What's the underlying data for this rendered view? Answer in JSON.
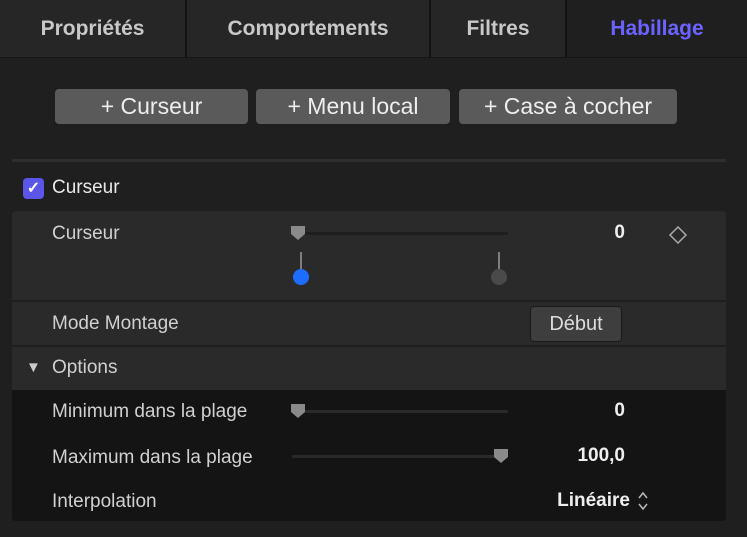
{
  "tabs": [
    {
      "label": "Propriétés"
    },
    {
      "label": "Comportements"
    },
    {
      "label": "Filtres"
    },
    {
      "label": "Habillage"
    }
  ],
  "buttons": {
    "add_slider": "+ Curseur",
    "add_popup": "+ Menu local",
    "add_checkbox": "+ Case à cocher"
  },
  "section": {
    "label": "Curseur",
    "checked": true
  },
  "slider_row": {
    "label": "Curseur",
    "value": "0",
    "fraction": 0
  },
  "edit_mode": {
    "label": "Mode Montage",
    "button": "Début"
  },
  "options": {
    "label": "Options",
    "min": {
      "label": "Minimum dans la plage",
      "value": "0",
      "fraction": 0
    },
    "max": {
      "label": "Maximum dans la plage",
      "value": "100,0",
      "fraction": 1
    },
    "interpolation": {
      "label": "Interpolation",
      "value": "Linéaire"
    }
  },
  "colors": {
    "accent": "#6b63ff",
    "checkbox": "#5b55e8",
    "blue_knob": "#1e6bff"
  }
}
